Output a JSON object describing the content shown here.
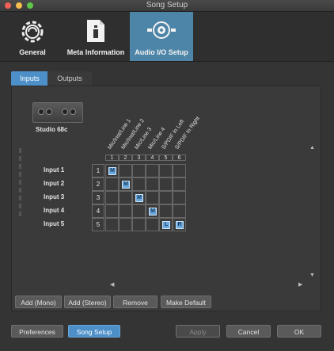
{
  "window": {
    "title": "Song Setup"
  },
  "toolbar": [
    {
      "label": "General",
      "icon": "gear-icon"
    },
    {
      "label": "Meta Information",
      "icon": "info-document-icon"
    },
    {
      "label": "Audio I/O Setup",
      "icon": "audio-io-icon"
    }
  ],
  "tabs": {
    "inputs": "Inputs",
    "outputs": "Outputs"
  },
  "device": {
    "name": "Studio 68c"
  },
  "columns": [
    {
      "num": "1",
      "label": "Mic/Inst/Line 1"
    },
    {
      "num": "2",
      "label": "Mic/Inst/Line 2"
    },
    {
      "num": "3",
      "label": "Mic/Line 3"
    },
    {
      "num": "4",
      "label": "Mic/Line 4"
    },
    {
      "num": "5",
      "label": "S/PDIF In Left"
    },
    {
      "num": "6",
      "label": "S/PDIF In Right"
    }
  ],
  "rows": [
    {
      "label": "Input 1",
      "num": "1"
    },
    {
      "label": "Input 2",
      "num": "2"
    },
    {
      "label": "Input 3",
      "num": "3"
    },
    {
      "label": "Input 4",
      "num": "4"
    },
    {
      "label": "Input 5",
      "num": "5"
    }
  ],
  "assignments": [
    {
      "row": 0,
      "col": 0,
      "mark": "M"
    },
    {
      "row": 1,
      "col": 1,
      "mark": "M"
    },
    {
      "row": 2,
      "col": 2,
      "mark": "M"
    },
    {
      "row": 3,
      "col": 3,
      "mark": "M"
    },
    {
      "row": 4,
      "col": 4,
      "mark": "L"
    },
    {
      "row": 4,
      "col": 5,
      "mark": "R"
    }
  ],
  "actions": {
    "add_mono": "Add (Mono)",
    "add_stereo": "Add (Stereo)",
    "remove": "Remove",
    "make_default": "Make Default"
  },
  "footer": {
    "preferences": "Preferences",
    "song_setup": "Song Setup",
    "apply": "Apply",
    "cancel": "Cancel",
    "ok": "OK"
  },
  "colors": {
    "accent": "#4d8fc9",
    "selected_tab": "#4d85a8"
  }
}
